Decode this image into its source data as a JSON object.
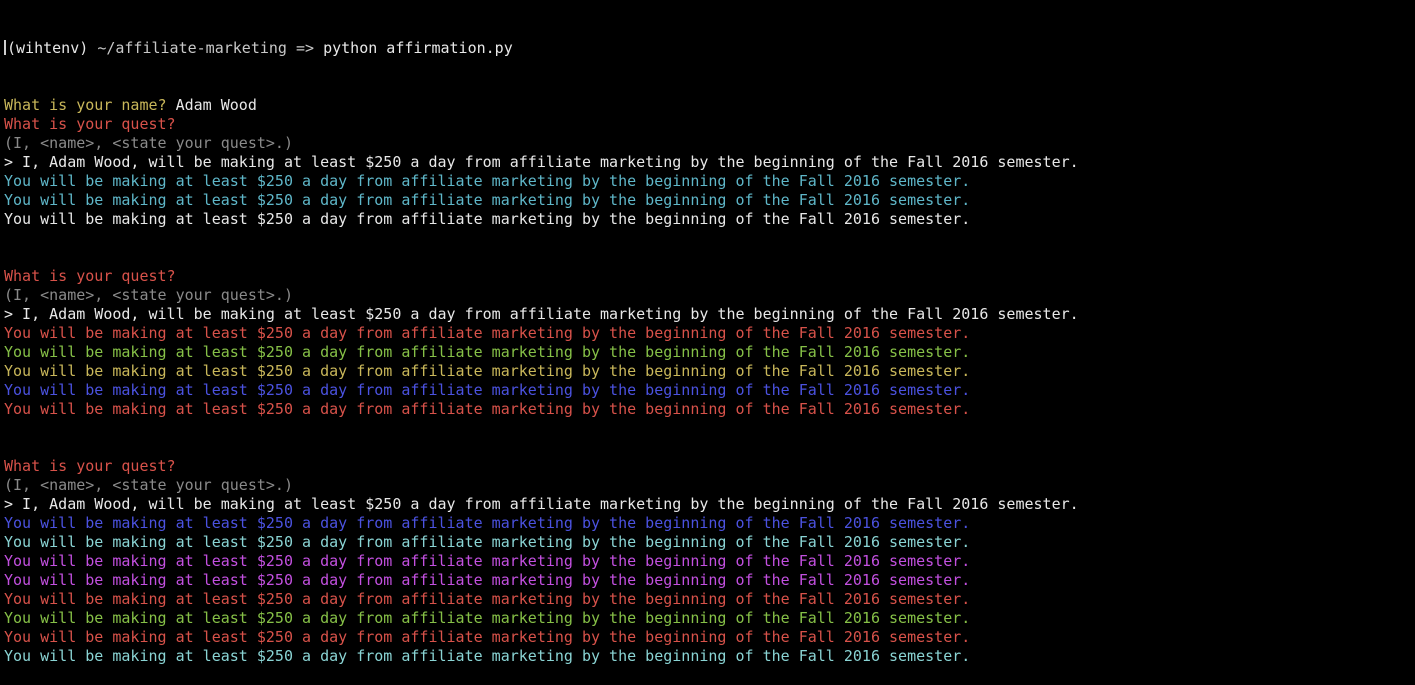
{
  "terminal": {
    "prompt": {
      "env": "(wihtenv)",
      "path": "~/affiliate-marketing",
      "arrow": "=>",
      "command": "python affirmation.py"
    },
    "colors": {
      "default": "#e8e8e8",
      "yellow": "#c9b75a",
      "red": "#d8524a",
      "gray": "#8a8a8a",
      "cyan": "#5fb7c9",
      "green": "#86c047",
      "blue": "#4b52e0",
      "magenta": "#c350e0",
      "teal": "#8ad4d4"
    },
    "lines": [
      {
        "text": "",
        "color": "default",
        "kind": "prompt"
      },
      {
        "text": "What is your name? ",
        "color": "yellow",
        "answer": "Adam Wood"
      },
      {
        "text": "What is your quest?",
        "color": "red"
      },
      {
        "text": "(I, <name>, <state your quest>.)",
        "color": "gray"
      },
      {
        "text": "> I, Adam Wood, will be making at least $250 a day from affiliate marketing by the beginning of the Fall 2016 semester.",
        "color": "default"
      },
      {
        "text": "You will be making at least $250 a day from affiliate marketing by the beginning of the Fall 2016 semester.",
        "color": "cyan"
      },
      {
        "text": "You will be making at least $250 a day from affiliate marketing by the beginning of the Fall 2016 semester.",
        "color": "cyan"
      },
      {
        "text": "You will be making at least $250 a day from affiliate marketing by the beginning of the Fall 2016 semester.",
        "color": "default"
      },
      {
        "text": "",
        "color": "default"
      },
      {
        "text": "",
        "color": "default"
      },
      {
        "text": "What is your quest?",
        "color": "red"
      },
      {
        "text": "(I, <name>, <state your quest>.)",
        "color": "gray"
      },
      {
        "text": "> I, Adam Wood, will be making at least $250 a day from affiliate marketing by the beginning of the Fall 2016 semester.",
        "color": "default"
      },
      {
        "text": "You will be making at least $250 a day from affiliate marketing by the beginning of the Fall 2016 semester.",
        "color": "red"
      },
      {
        "text": "You will be making at least $250 a day from affiliate marketing by the beginning of the Fall 2016 semester.",
        "color": "green"
      },
      {
        "text": "You will be making at least $250 a day from affiliate marketing by the beginning of the Fall 2016 semester.",
        "color": "yellow"
      },
      {
        "text": "You will be making at least $250 a day from affiliate marketing by the beginning of the Fall 2016 semester.",
        "color": "blue"
      },
      {
        "text": "You will be making at least $250 a day from affiliate marketing by the beginning of the Fall 2016 semester.",
        "color": "red"
      },
      {
        "text": "",
        "color": "default"
      },
      {
        "text": "",
        "color": "default"
      },
      {
        "text": "What is your quest?",
        "color": "red"
      },
      {
        "text": "(I, <name>, <state your quest>.)",
        "color": "gray"
      },
      {
        "text": "> I, Adam Wood, will be making at least $250 a day from affiliate marketing by the beginning of the Fall 2016 semester.",
        "color": "default"
      },
      {
        "text": "You will be making at least $250 a day from affiliate marketing by the beginning of the Fall 2016 semester.",
        "color": "blue"
      },
      {
        "text": "You will be making at least $250 a day from affiliate marketing by the beginning of the Fall 2016 semester.",
        "color": "teal"
      },
      {
        "text": "You will be making at least $250 a day from affiliate marketing by the beginning of the Fall 2016 semester.",
        "color": "magenta"
      },
      {
        "text": "You will be making at least $250 a day from affiliate marketing by the beginning of the Fall 2016 semester.",
        "color": "magenta"
      },
      {
        "text": "You will be making at least $250 a day from affiliate marketing by the beginning of the Fall 2016 semester.",
        "color": "red"
      },
      {
        "text": "You will be making at least $250 a day from affiliate marketing by the beginning of the Fall 2016 semester.",
        "color": "green"
      },
      {
        "text": "You will be making at least $250 a day from affiliate marketing by the beginning of the Fall 2016 semester.",
        "color": "red"
      },
      {
        "text": "You will be making at least $250 a day from affiliate marketing by the beginning of the Fall 2016 semester.",
        "color": "teal"
      }
    ]
  }
}
